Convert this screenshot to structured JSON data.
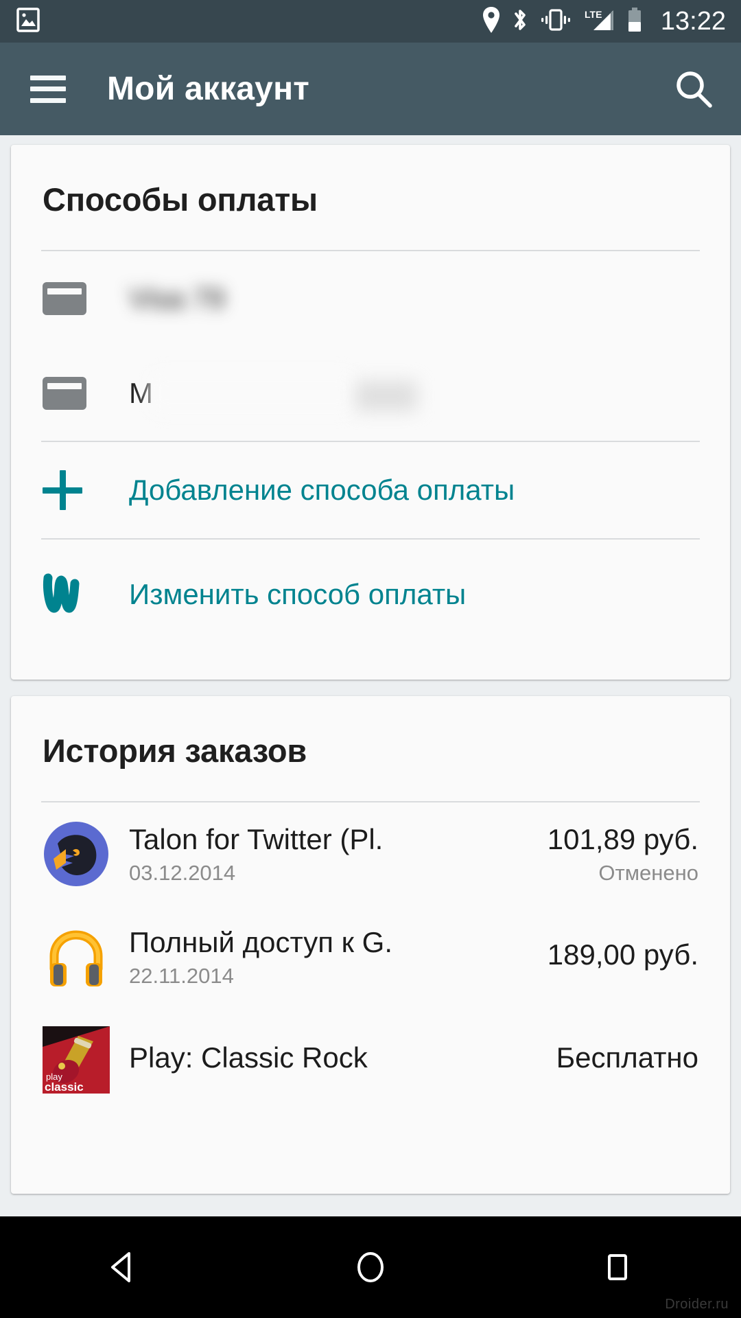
{
  "status_bar": {
    "time": "13:22",
    "icons": [
      "photo-icon",
      "location-pin-icon",
      "bluetooth-icon",
      "vibrate-icon",
      "lte-signal-icon",
      "battery-icon"
    ]
  },
  "app_bar": {
    "title": "Мой аккаунт",
    "menu_icon": "hamburger-menu-icon",
    "search_icon": "search-icon"
  },
  "theme": {
    "status_bar_bg": "#37474f",
    "app_bar_bg": "#455a64",
    "page_bg": "#eceff1",
    "card_bg": "#fafafa",
    "accent_teal": "#00838f",
    "text_primary": "#1c1c1c",
    "text_secondary": "#8b8b8b"
  },
  "payment_card": {
    "title": "Способы оплаты",
    "methods": [
      {
        "label": "Visa 79",
        "icon": "credit-card-icon",
        "masked": true
      },
      {
        "label": "M",
        "icon": "credit-card-icon",
        "masked": true
      }
    ],
    "actions": [
      {
        "label": "Добавление способа оплаты",
        "icon": "plus-icon"
      },
      {
        "label": "Изменить способ оплаты",
        "icon": "wallet-w-icon"
      }
    ]
  },
  "order_history": {
    "title": "История заказов",
    "orders": [
      {
        "name": "Talon for Twitter (Pl.",
        "date": "03.12.2014",
        "price": "101,89 руб.",
        "status": "Отменено",
        "icon": "talon-bird-icon"
      },
      {
        "name": "Полный доступ к G.",
        "date": "22.11.2014",
        "price": "189,00 руб.",
        "status": "",
        "icon": "play-music-headphones-icon"
      },
      {
        "name": "Play: Classic Rock",
        "date": "",
        "price": "Бесплатно",
        "status": "",
        "icon": "classic-rock-album-icon"
      }
    ]
  },
  "nav_bar": {
    "back": "back-triangle-icon",
    "home": "home-circle-icon",
    "recents": "recents-square-icon"
  },
  "watermark": "Droider.ru"
}
